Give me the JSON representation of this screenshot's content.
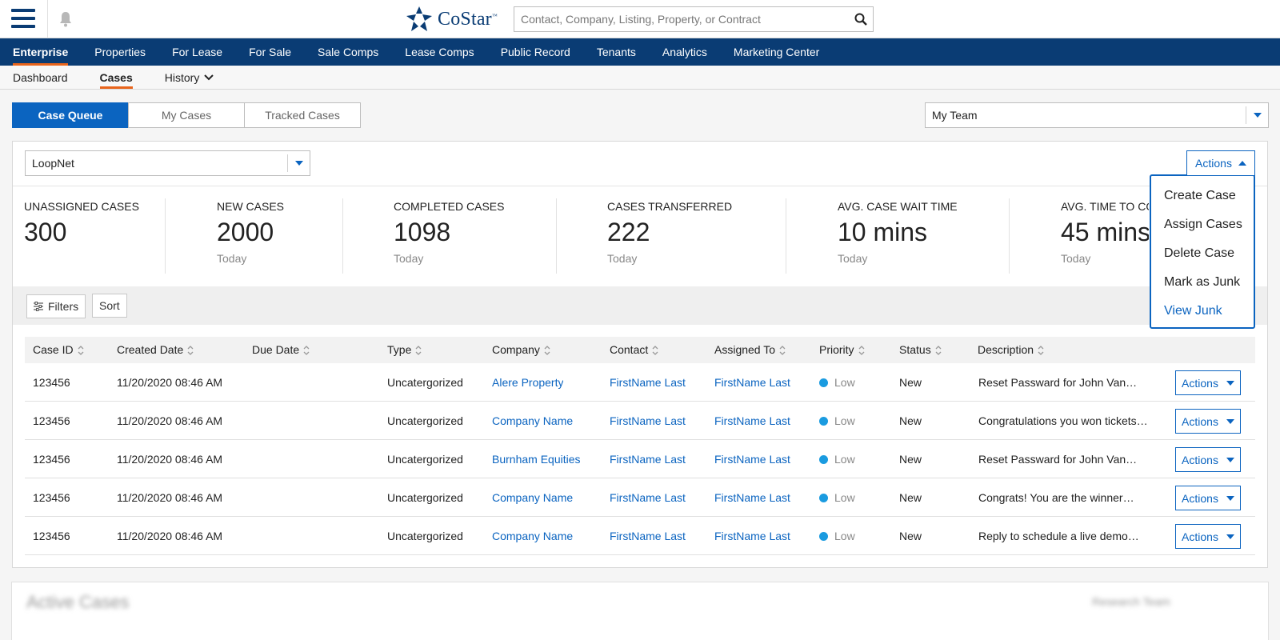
{
  "header": {
    "logo_text": "CoStar",
    "logo_tm": "™",
    "search_placeholder": "Contact, Company, Listing, Property, or Contract"
  },
  "main_nav": [
    "Enterprise",
    "Properties",
    "For Lease",
    "For Sale",
    "Sale Comps",
    "Lease Comps",
    "Public Record",
    "Tenants",
    "Analytics",
    "Marketing Center"
  ],
  "sub_nav": {
    "dashboard": "Dashboard",
    "cases": "Cases",
    "history": "History"
  },
  "queue_tabs": [
    "Case Queue",
    "My Cases",
    "Tracked Cases"
  ],
  "team_select": "My Team",
  "source_select": "LoopNet",
  "actions_label": "Actions",
  "stats": [
    {
      "label": "UNASSIGNED CASES",
      "value": "300",
      "sub": ""
    },
    {
      "label": "NEW CASES",
      "value": "2000",
      "sub": "Today"
    },
    {
      "label": "COMPLETED CASES",
      "value": "1098",
      "sub": "Today"
    },
    {
      "label": "CASES TRANSFERRED",
      "value": "222",
      "sub": "Today"
    },
    {
      "label": "AVG. CASE WAIT TIME",
      "value": "10 mins",
      "sub": "Today"
    },
    {
      "label": "AVG. TIME TO CO",
      "value": "45 mins",
      "sub": "Today"
    }
  ],
  "filter_bar": {
    "filters": "Filters",
    "sort": "Sort"
  },
  "table": {
    "columns": [
      "Case ID",
      "Created Date",
      "Due Date",
      "Type",
      "Company",
      "Contact",
      "Assigned To",
      "Priority",
      "Status",
      "Description"
    ],
    "rows": [
      {
        "id": "123456",
        "created": "11/20/2020 08:46 AM",
        "due": "",
        "type": "Uncatergorized",
        "company": "Alere Property",
        "contact": "FirstName Last",
        "assigned": "FirstName Last",
        "priority": "Low",
        "status": "New",
        "description": "Reset Passward for John Van…",
        "action": "Actions"
      },
      {
        "id": "123456",
        "created": "11/20/2020 08:46 AM",
        "due": "",
        "type": "Uncatergorized",
        "company": "Company Name",
        "contact": "FirstName Last",
        "assigned": "FirstName Last",
        "priority": "Low",
        "status": "New",
        "description": "Congratulations you won tickets…",
        "action": "Actions"
      },
      {
        "id": "123456",
        "created": "11/20/2020 08:46 AM",
        "due": "",
        "type": "Uncatergorized",
        "company": "Burnham Equities",
        "contact": "FirstName Last",
        "assigned": "FirstName Last",
        "priority": "Low",
        "status": "New",
        "description": "Reset Passward for John Van…",
        "action": "Actions"
      },
      {
        "id": "123456",
        "created": "11/20/2020 08:46 AM",
        "due": "",
        "type": "Uncatergorized",
        "company": "Company Name",
        "contact": "FirstName Last",
        "assigned": "FirstName Last",
        "priority": "Low",
        "status": "New",
        "description": "Congrats! You are the winner…",
        "action": "Actions"
      },
      {
        "id": "123456",
        "created": "11/20/2020 08:46 AM",
        "due": "",
        "type": "Uncatergorized",
        "company": "Company Name",
        "contact": "FirstName Last",
        "assigned": "FirstName Last",
        "priority": "Low",
        "status": "New",
        "description": "Reply to schedule a live demo…",
        "action": "Actions"
      }
    ]
  },
  "actions_menu": [
    "Create Case",
    "Assign Cases",
    "Delete Case",
    "Mark as Junk",
    "View Junk"
  ],
  "bottom_card": {
    "title": "Active Cases",
    "select": "Research Team"
  },
  "colors": {
    "brand_navy": "#0a3c74",
    "accent_blue": "#0b64c0",
    "active_underline": "#e8641b",
    "priority_low": "#1a9be0"
  }
}
